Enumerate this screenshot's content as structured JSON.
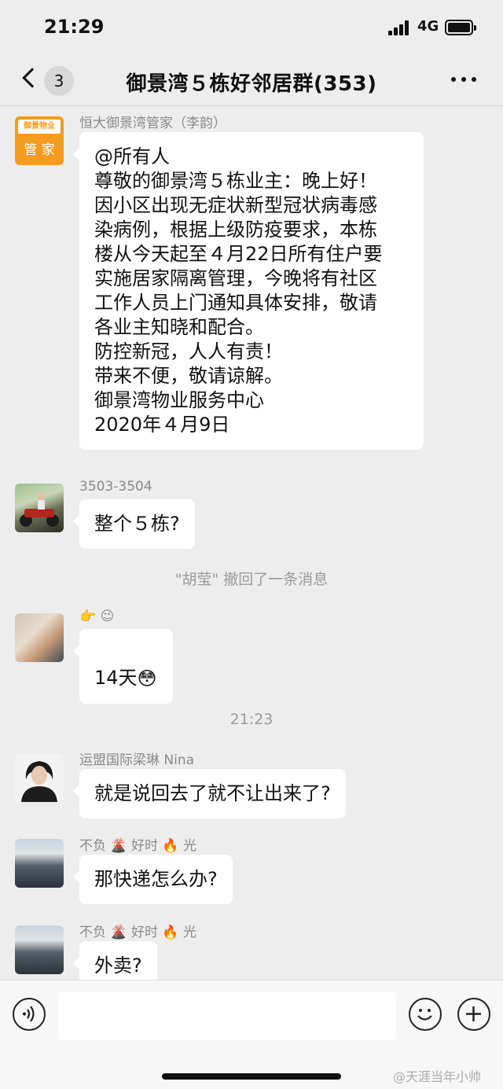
{
  "status_bar": {
    "time": "21:29",
    "network": "4G"
  },
  "nav": {
    "unread_count": "3",
    "title": "御景湾５栋好邻居群(353)"
  },
  "messages": [
    {
      "sender": "恒大御景湾管家（李韵）",
      "avatar_text": "管 家",
      "avatar_logo": "御景物业",
      "text": "@所有人\n尊敬的御景湾５栋业主：晚上好！\n因小区出现无症状新型冠状病毒感\n染病例，根据上级防疫要求，本栋\n楼从今天起至４月22日所有住户要\n实施居家隔离管理，今晚将有社区\n工作人员上门通知具体安排，敬请\n各业主知晓和配合。\n防控新冠，人人有责！\n带来不便，敬请谅解。\n御景湾物业服务中心\n2020年４月9日"
    },
    {
      "sender": "3503-3504",
      "text": "整个５栋?"
    },
    {
      "sender": "👉 😉",
      "text": "14天",
      "text_emoji": "😳"
    },
    {
      "sender": "运盟国际梁琳 Nina",
      "text": "就是说回去了就不让出来了?"
    },
    {
      "sender_parts": [
        "不负",
        "🌋",
        "好时",
        "🔥",
        "光"
      ],
      "text": "那快递怎么办?"
    },
    {
      "sender_parts": [
        "不负",
        "🌋",
        "好时",
        "🔥",
        "光"
      ],
      "text": "外卖?"
    }
  ],
  "system": {
    "recall_notice": "\"胡莹\" 撤回了一条消息",
    "timestamp": "21:23"
  },
  "watermark": "@天涯当年小帅"
}
